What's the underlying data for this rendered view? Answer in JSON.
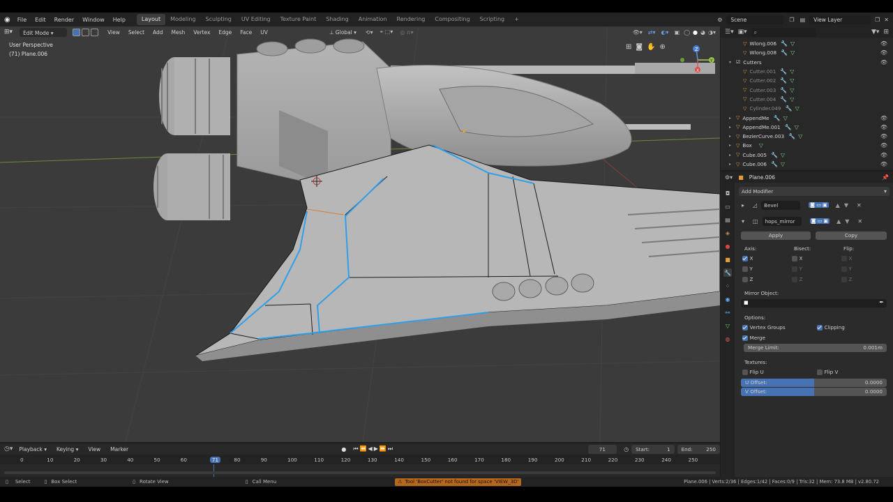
{
  "topbar": {
    "menus": [
      "File",
      "Edit",
      "Render",
      "Window",
      "Help"
    ],
    "workspaces": [
      "Layout",
      "Modeling",
      "Sculpting",
      "UV Editing",
      "Texture Paint",
      "Shading",
      "Animation",
      "Rendering",
      "Compositing",
      "Scripting"
    ],
    "active_workspace": "Layout",
    "add_tab": "+",
    "scene_label": "Scene",
    "view_layer_label": "View Layer"
  },
  "viewport": {
    "mode": "Edit Mode",
    "menus": [
      "View",
      "Select",
      "Add",
      "Mesh",
      "Vertex",
      "Edge",
      "Face",
      "UV"
    ],
    "orientation": "Global",
    "overlay_text_1": "User Perspective",
    "overlay_text_2": "(71) Plane.006",
    "gizmo_x": "X",
    "gizmo_y": "Y",
    "gizmo_z": "Z"
  },
  "outliner": {
    "items": [
      {
        "name": "Wlong.006",
        "dim": false,
        "indent": 1
      },
      {
        "name": "Wlong.008",
        "dim": false,
        "indent": 1
      },
      {
        "name": "Cutters",
        "dim": false,
        "indent": 0
      },
      {
        "name": "Cutter.001",
        "dim": true,
        "indent": 1
      },
      {
        "name": "Cutter.002",
        "dim": true,
        "indent": 1
      },
      {
        "name": "Cutter.003",
        "dim": true,
        "indent": 1
      },
      {
        "name": "Cutter.004",
        "dim": true,
        "indent": 1
      },
      {
        "name": "Cylinder.049",
        "dim": true,
        "indent": 1
      },
      {
        "name": "AppendMe",
        "dim": false,
        "indent": 0
      },
      {
        "name": "AppendMe.001",
        "dim": false,
        "indent": 0
      },
      {
        "name": "BezierCurve.003",
        "dim": false,
        "indent": 0
      },
      {
        "name": "Box",
        "dim": false,
        "indent": 0
      },
      {
        "name": "Cube.005",
        "dim": false,
        "indent": 0
      },
      {
        "name": "Cube.006",
        "dim": false,
        "indent": 0
      }
    ]
  },
  "properties": {
    "object_name": "Plane.006",
    "add_modifier": "Add Modifier",
    "modifier_1": "Bevel",
    "modifier_2": "hops_mirror",
    "apply": "Apply",
    "copy": "Copy",
    "axis_label": "Axis:",
    "bisect_label": "Bisect:",
    "flip_label": "Flip:",
    "x": "X",
    "y": "Y",
    "z": "Z",
    "mirror_object_label": "Mirror Object:",
    "options_label": "Options:",
    "vertex_groups": "Vertex Groups",
    "clipping": "Clipping",
    "merge": "Merge",
    "merge_limit_label": "Merge Limit:",
    "merge_limit_value": "0.001m",
    "textures_label": "Textures:",
    "flip_u": "Flip U",
    "flip_v": "Flip V",
    "u_offset_label": "U Offset:",
    "u_offset_value": "0.0000",
    "v_offset_label": "V Offset:",
    "v_offset_value": "0.0000"
  },
  "timeline": {
    "menus": [
      "Playback",
      "Keying",
      "View",
      "Marker"
    ],
    "current_frame": "71",
    "start_label": "Start:",
    "start_value": "1",
    "end_label": "End:",
    "end_value": "250",
    "ticks": [
      "0",
      "10",
      "20",
      "30",
      "40",
      "50",
      "60",
      "71",
      "80",
      "90",
      "100",
      "110",
      "120",
      "130",
      "140",
      "150",
      "160",
      "170",
      "180",
      "190",
      "200",
      "210",
      "220",
      "230",
      "240",
      "250"
    ]
  },
  "status": {
    "select": "Select",
    "box_select": "Box Select",
    "rotate_view": "Rotate View",
    "call_menu": "Call Menu",
    "warning": "Tool 'BoxCutter' not found for space 'VIEW_3D'",
    "stats": "Plane.006 | Verts:2/36 | Edges:1/42 | Faces:0/9 | Tris:32 | Mem: 73.8 MB | v2.80.72"
  },
  "colors": {
    "selection_blue": "#4772b3",
    "edge_highlight": "#2f9fe8",
    "viewport_bg": "#3b3b3b",
    "panel_bg": "#2b2b2b",
    "warning_orange": "#b8681c"
  }
}
